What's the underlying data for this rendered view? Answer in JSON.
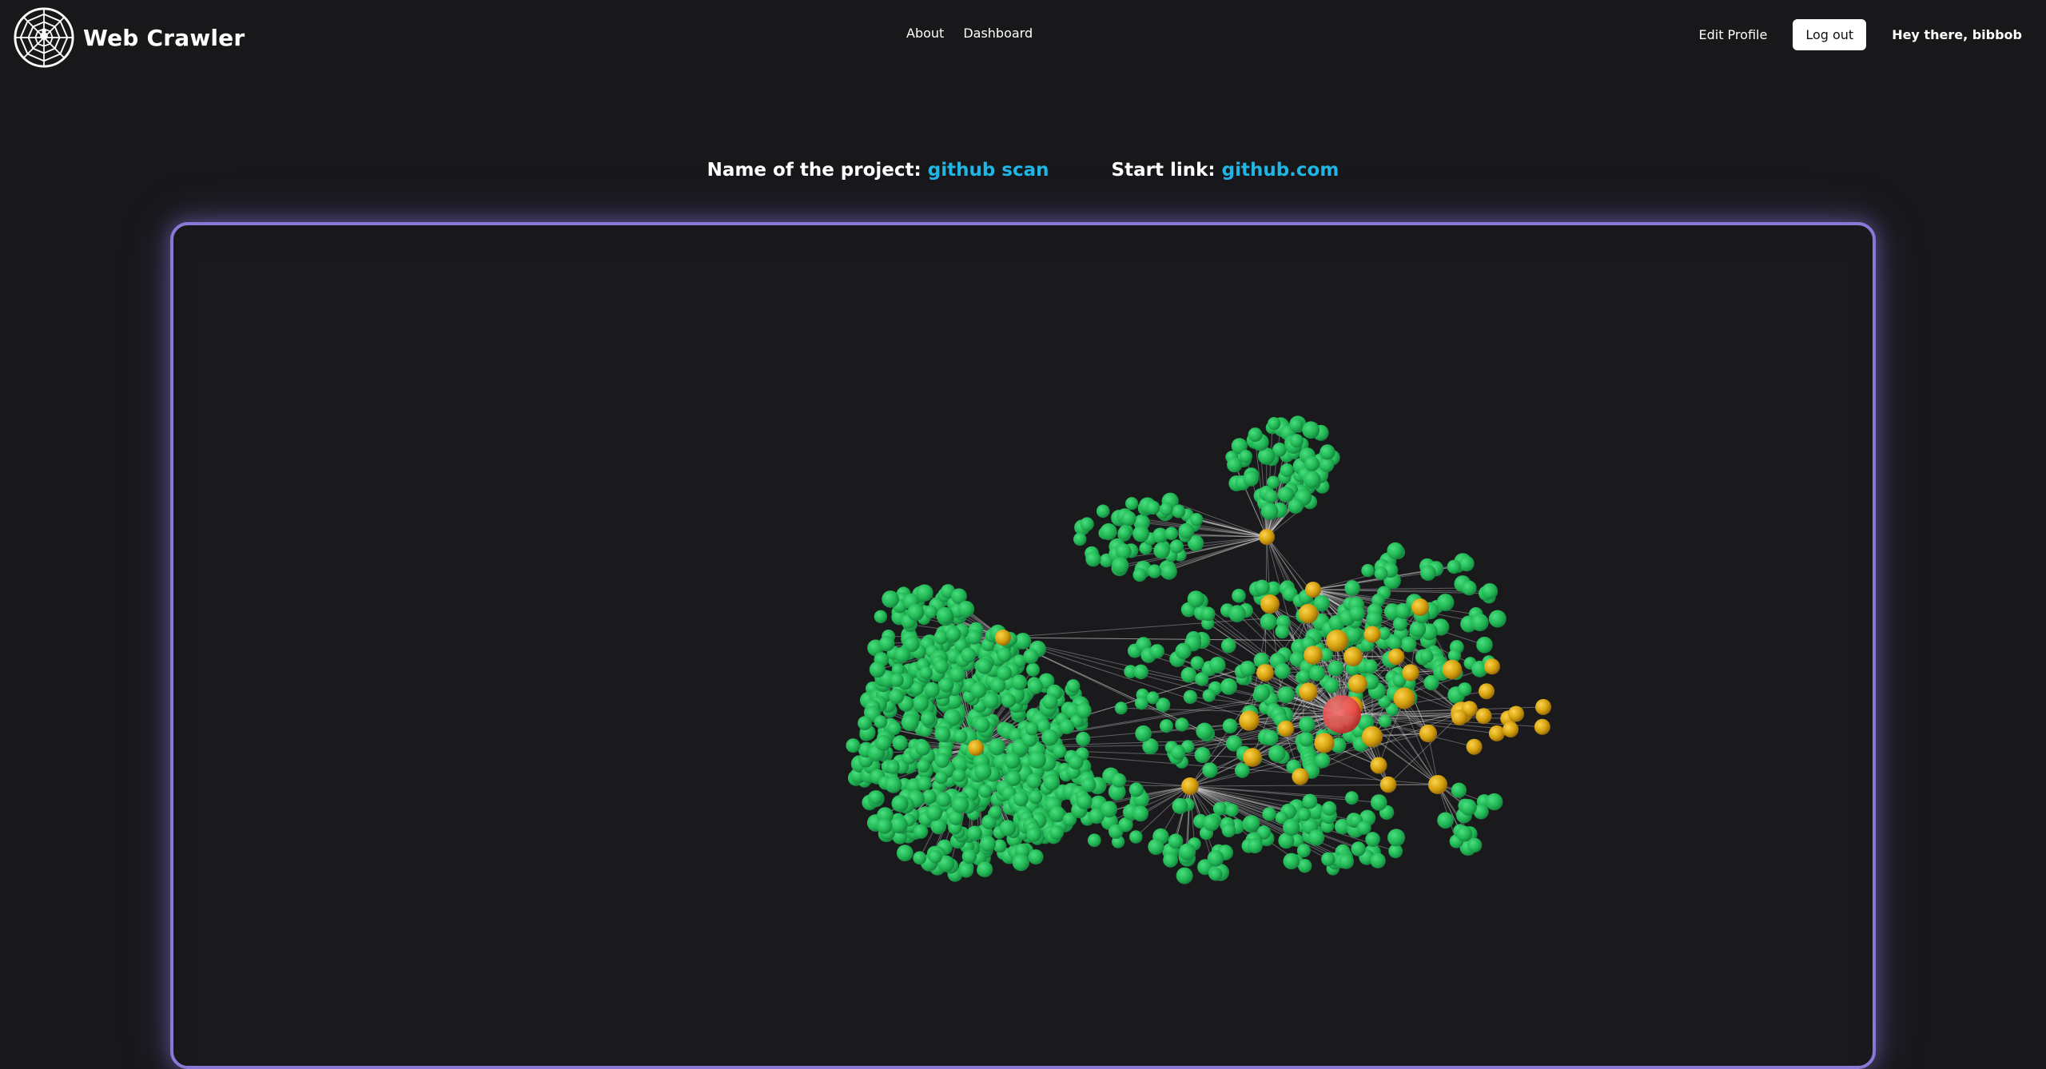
{
  "brand": {
    "title": "Web Crawler",
    "logo_icon": "spider-web-icon"
  },
  "nav": {
    "about": "About",
    "dashboard": "Dashboard"
  },
  "user": {
    "edit_profile": "Edit Profile",
    "logout": "Log out",
    "greeting": "Hey there, bibbob"
  },
  "project": {
    "name_label": "Name of the project:",
    "name_value": "github scan",
    "start_label": "Start link:",
    "start_value": "github.com"
  },
  "colors": {
    "background": "#18181b",
    "accent": "#1fb6e6",
    "panel_border": "#8b78d6",
    "node_leaf": "#22c55e",
    "node_hub": "#d4a00d",
    "node_root": "#e5484d",
    "edge": "#e5e5e5"
  }
}
